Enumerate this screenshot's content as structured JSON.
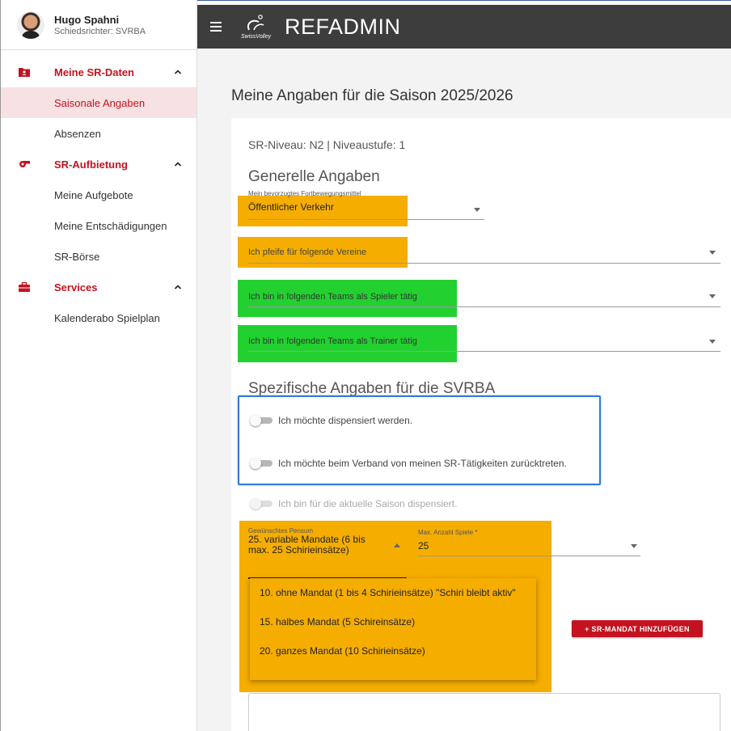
{
  "user": {
    "name": "Hugo Spahni",
    "role": "Schiedsrichter: SVRBA"
  },
  "sidebar": {
    "groups": [
      {
        "label": "Meine SR-Daten",
        "icon": "folder-person-icon",
        "items": [
          "Saisonale Angaben",
          "Absenzen"
        ]
      },
      {
        "label": "SR-Aufbietung",
        "icon": "whistle-icon",
        "items": [
          "Meine Aufgebote",
          "Meine Entschädigungen",
          "SR-Börse"
        ]
      },
      {
        "label": "Services",
        "icon": "briefcase-icon",
        "items": [
          "Kalenderabo Spielplan"
        ]
      }
    ],
    "active_item": "Saisonale Angaben"
  },
  "topbar": {
    "logo_text": "SwissVolley",
    "app_title": "REFADMIN"
  },
  "main": {
    "page_title": "Meine Angaben für die Saison 2025/2026",
    "niveau": "SR-Niveau: N2 | Niveaustufe: 1",
    "general": {
      "heading": "Generelle Angaben",
      "transport_label": "Mein bevorzugtes Fortbewegungsmittel",
      "transport_value": "Öffentlicher Verkehr",
      "clubs_placeholder": "Ich pfeife für folgende Vereine",
      "player_teams_placeholder": "Ich bin in folgenden Teams als Spieler tätig",
      "trainer_teams_placeholder": "Ich bin in folgenden Teams als Trainer tätig"
    },
    "specific": {
      "heading": "Spezifische Angaben für die SVRBA",
      "toggle_dispense": "Ich möchte dispensiert werden.",
      "toggle_resign": "Ich möchte beim Verband von meinen SR-Tätigkeiten zurücktreten.",
      "toggle_dispensed_current": "Ich bin für die aktuelle Saison dispensiert."
    },
    "pensum": {
      "label": "Gewünschtes Pensum",
      "value": "25. variable Mandate (6 bis max. 25 Schirieinsätze)",
      "options": [
        "10. ohne Mandat (1 bis 4 Schirieinsätze) \"Schiri bleibt aktiv\"",
        "15. halbes Mandat (5 Schireinsätze)",
        "20. ganzes Mandat (10 Schirieinsätze)"
      ]
    },
    "max_games": {
      "label": "Max. Anzahl Spiele *",
      "value": "25"
    },
    "add_mandat_button": "+ SR-MANDAT HINZUFÜGEN"
  },
  "colors": {
    "accent": "#c5121f",
    "highlight_orange": "#f5ad00",
    "highlight_green": "#22d130",
    "focus_blue": "#2f7bd8"
  }
}
